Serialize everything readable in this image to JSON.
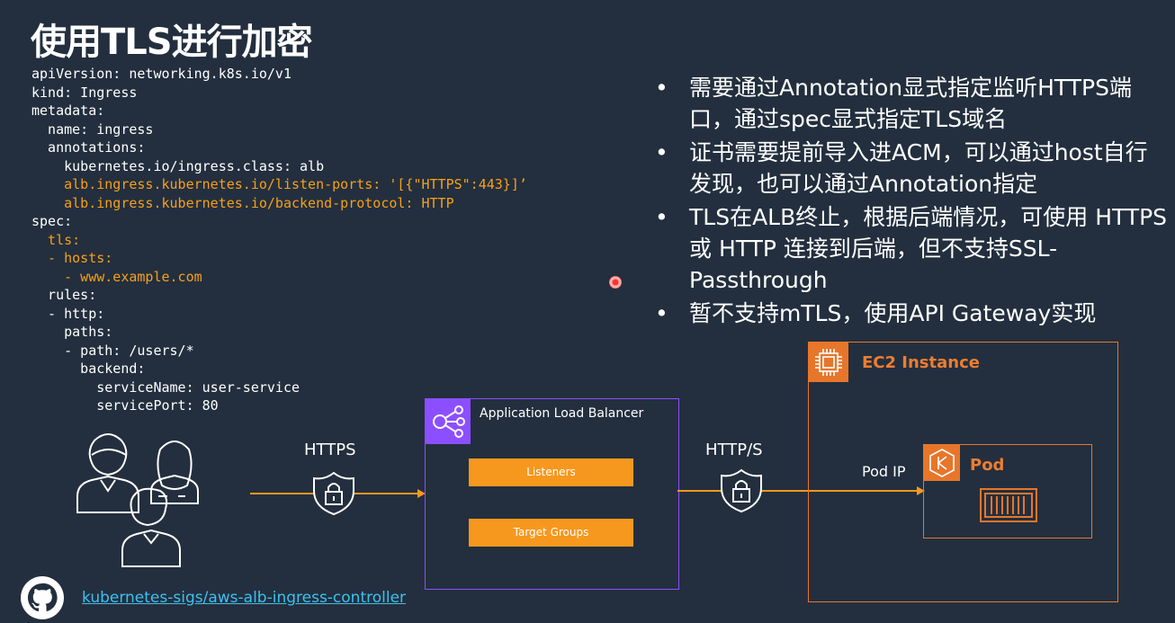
{
  "slide": {
    "title": "使用TLS进行加密",
    "code_lines": [
      {
        "text": "apiVersion: networking.k8s.io/v1",
        "color": "white"
      },
      {
        "text": "kind: Ingress",
        "color": "white"
      },
      {
        "text": "metadata:",
        "color": "white"
      },
      {
        "text": "  name: ingress",
        "color": "white"
      },
      {
        "text": "  annotations:",
        "color": "white"
      },
      {
        "text": "    kubernetes.io/ingress.class: alb",
        "color": "white"
      },
      {
        "text": "    alb.ingress.kubernetes.io/listen-ports: '[{\"HTTPS\":443}]’",
        "color": "orange"
      },
      {
        "text": "    alb.ingress.kubernetes.io/backend-protocol: HTTP",
        "color": "orange"
      },
      {
        "text": "spec:",
        "color": "white"
      },
      {
        "text": "  tls:",
        "color": "orange"
      },
      {
        "text": "  - hosts:",
        "color": "orange"
      },
      {
        "text": "    - www.example.com",
        "color": "orange"
      },
      {
        "text": "  rules:",
        "color": "white"
      },
      {
        "text": "  - http:",
        "color": "white"
      },
      {
        "text": "    paths:",
        "color": "white"
      },
      {
        "text": "    - path: /users/*",
        "color": "white"
      },
      {
        "text": "      backend:",
        "color": "white"
      },
      {
        "text": "        serviceName: user-service",
        "color": "white"
      },
      {
        "text": "        servicePort: 80",
        "color": "white"
      }
    ],
    "bullets": [
      "需要通过Annotation显式指定监听HTTPS端口，通过spec显式指定TLS域名",
      "证书需要提前导入进ACM，可以通过host自行发现，也可以通过Annotation指定",
      "TLS在ALB终止，根据后端情况，可使用 HTTPS 或 HTTP 连接到后端，但不支持SSL-Passthrough",
      "暂不支持mTLS，使用API Gateway实现"
    ],
    "bullet_symbol": "•",
    "diagram": {
      "https_label": "HTTPS",
      "https_s_label": "HTTP/S",
      "alb_title": "Application Load Balancer",
      "listeners": "Listeners",
      "target_groups": "Target Groups",
      "ec2_title": "EC2 Instance",
      "pod_title": "Pod",
      "pod_ip_label": "Pod IP"
    },
    "link_text": "kubernetes-sigs/aws-alb-ingress-controller",
    "colors": {
      "background": "#232f3e",
      "code_orange": "#f7a01a",
      "alb_purple": "#8c4fff",
      "ec2_orange": "#e7762b",
      "link_blue": "#3ec0f0"
    },
    "icons": [
      "users-icon",
      "shield-lock-icon",
      "alb-icon",
      "ec2-chip-icon",
      "eks-pod-icon",
      "container-icon",
      "github-icon",
      "laser-pointer-icon"
    ]
  }
}
